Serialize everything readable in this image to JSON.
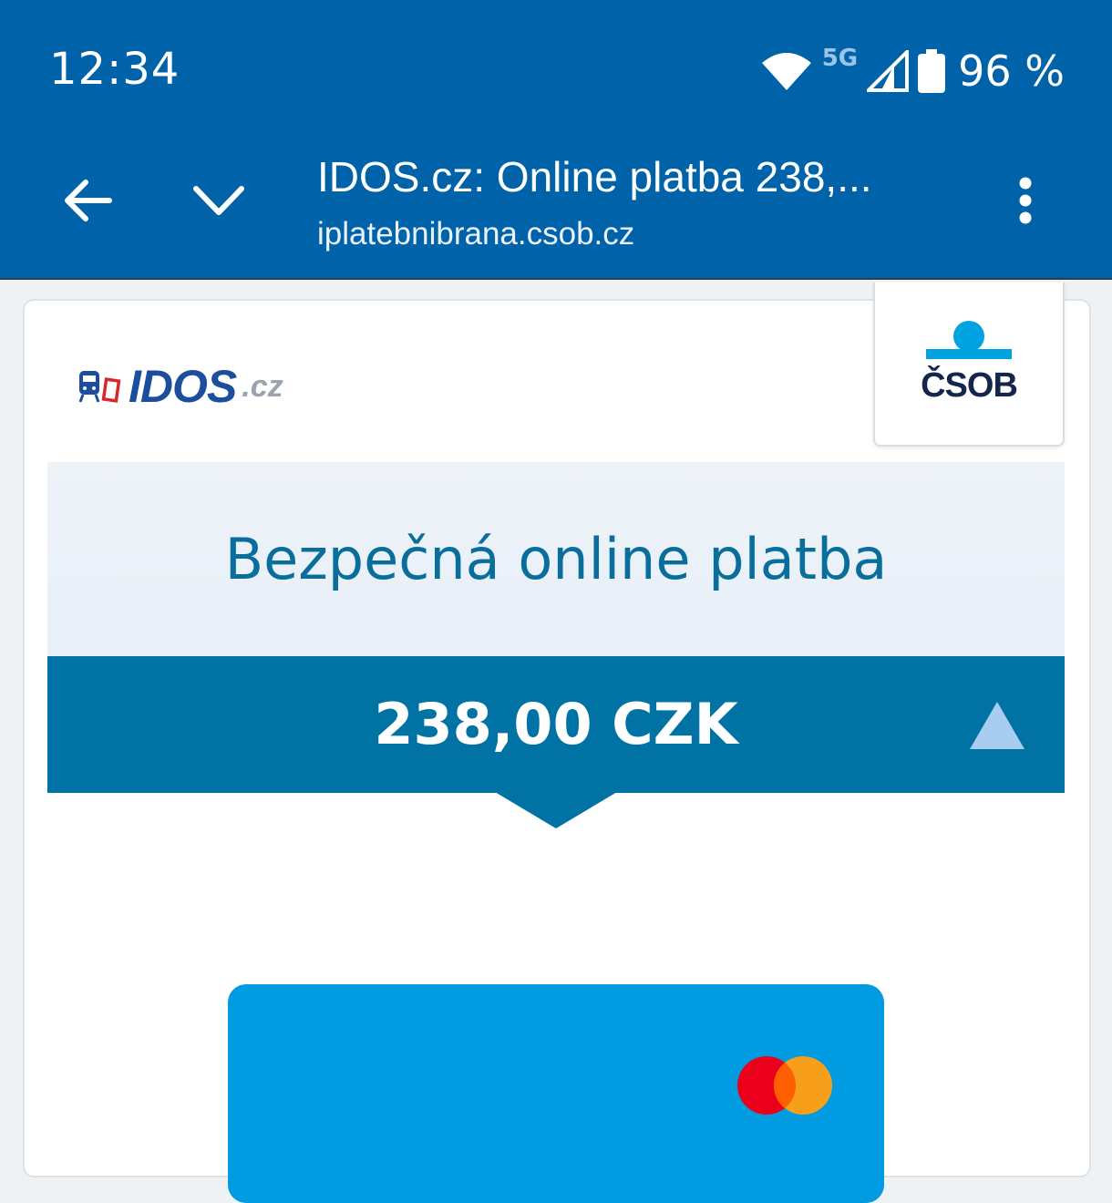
{
  "status_bar": {
    "time": "12:34",
    "network": "5G",
    "battery": "96 %",
    "icons": [
      "wifi-icon",
      "cell-signal-icon",
      "battery-icon"
    ]
  },
  "toolbar": {
    "title": "IDOS.cz: Online platba 238,...",
    "url": "iplatebnibrana.csob.cz",
    "icons": [
      "back-arrow-icon",
      "chevron-down-icon",
      "more-vert-icon"
    ]
  },
  "merchant": {
    "name": "IDOS",
    "suffix": ".cz"
  },
  "bank": {
    "name": "ČSOB"
  },
  "payment": {
    "heading": "Bezpečná online platba",
    "amount": "238,00 CZK"
  },
  "colors": {
    "brand_blue": "#0063aa",
    "amount_bar": "#0072a3",
    "heading_text": "#0a6e9c",
    "card_blue": "#019be2"
  }
}
